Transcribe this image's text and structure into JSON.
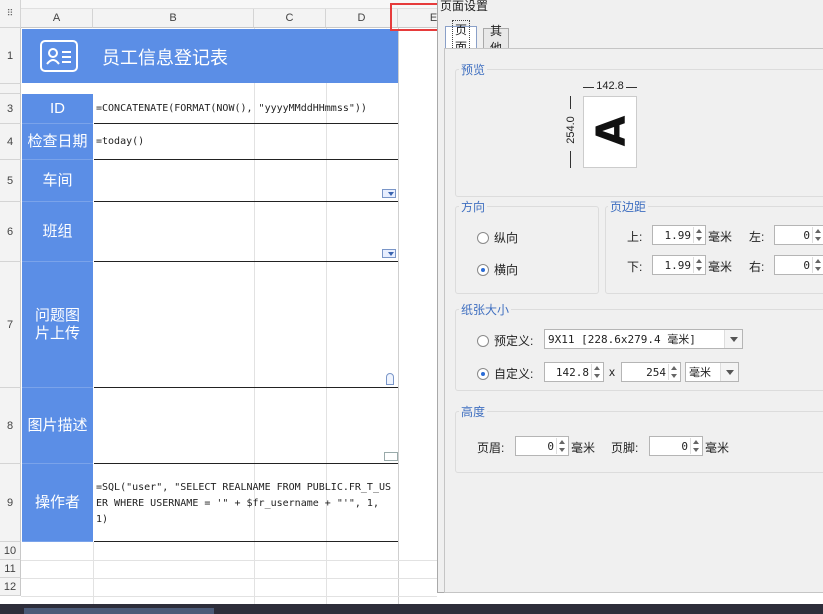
{
  "sheet": {
    "columns": [
      "A",
      "B",
      "C",
      "D",
      "E"
    ],
    "rows": [
      "1",
      "3",
      "4",
      "5",
      "6",
      "7",
      "8",
      "9",
      "10",
      "11",
      "12"
    ],
    "title": "员工信息登记表",
    "fields": [
      {
        "label": "ID",
        "formula": "=CONCATENATE(FORMAT(NOW(), \"yyyyMMddHHmmss\"))"
      },
      {
        "label": "检查日期",
        "formula": "=today()"
      },
      {
        "label": "车间",
        "formula": ""
      },
      {
        "label": "班组",
        "formula": ""
      },
      {
        "label": "问题图片上传",
        "formula": ""
      },
      {
        "label": "图片描述",
        "formula": ""
      },
      {
        "label": "操作者",
        "formula": "=SQL(\"user\", \"SELECT REALNAME FROM PUBLIC.FR_T_USER WHERE USERNAME = '\" + $fr_username + \"'\", 1, 1)"
      }
    ]
  },
  "dialog": {
    "title": "页面设置",
    "tabs": [
      "页面",
      "其他"
    ],
    "preview": {
      "label": "预览",
      "width": "142.8",
      "height": "254.0",
      "letter": "A"
    },
    "orientation": {
      "label": "方向",
      "portrait": "纵向",
      "landscape": "横向",
      "selected": "landscape"
    },
    "margins": {
      "label": "页边距",
      "top_label": "上:",
      "top_value": "1.99",
      "bottom_label": "下:",
      "bottom_value": "1.99",
      "left_label": "左:",
      "left_value": "0",
      "right_label": "右:",
      "right_value": "0",
      "unit": "毫米"
    },
    "paper": {
      "label": "纸张大小",
      "predefined_label": "预定义:",
      "predefined_value": "9X11 [228.6x279.4 毫米]",
      "custom_label": "自定义:",
      "custom_width": "142.8",
      "times": "x",
      "custom_height": "254",
      "unit": "毫米",
      "selected": "custom"
    },
    "height": {
      "label": "高度",
      "header_label": "页眉:",
      "header_value": "0",
      "footer_label": "页脚:",
      "footer_value": "0",
      "unit": "毫米"
    }
  }
}
